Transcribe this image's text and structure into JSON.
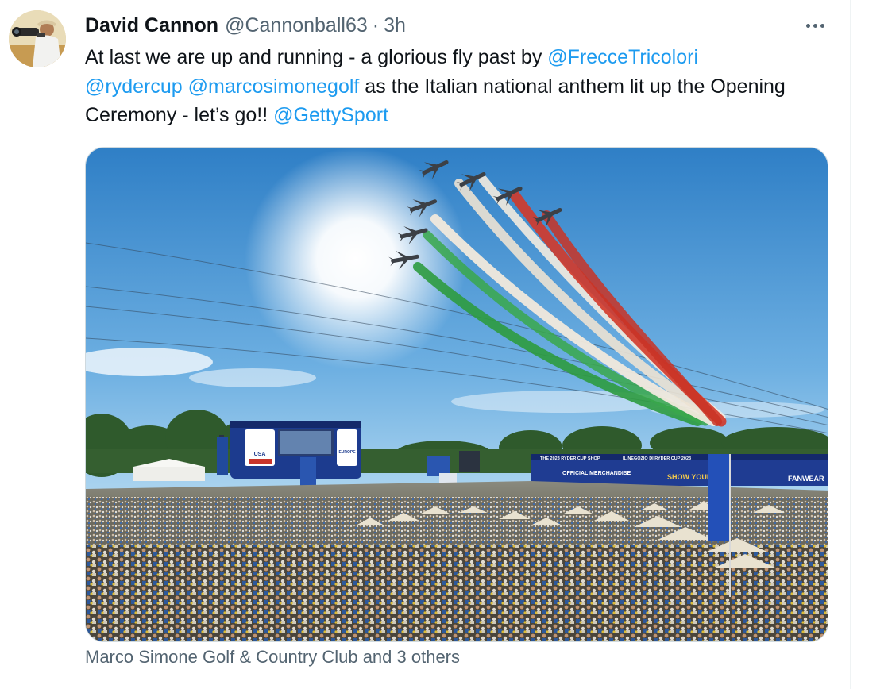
{
  "tweet": {
    "author": {
      "display_name": "David Cannon",
      "handle": "@Cannonball63",
      "separator": "·",
      "time": "3h"
    },
    "text_parts": [
      {
        "type": "text",
        "value": "At last we are up and running - a glorious fly past by "
      },
      {
        "type": "mention",
        "value": "@FrecceTricolori"
      },
      {
        "type": "text",
        "value": " "
      },
      {
        "type": "mention",
        "value": "@rydercup"
      },
      {
        "type": "text",
        "value": " "
      },
      {
        "type": "mention",
        "value": "@marcosimonegolf"
      },
      {
        "type": "text",
        "value": " as the Italian national anthem lit up the Opening Ceremony - let’s go!! "
      },
      {
        "type": "mention",
        "value": "@GettySport"
      }
    ],
    "media": {
      "signage": {
        "usa": "USA",
        "europe": "EUROPE",
        "shop": "THE 2023 RYDER CUP SHOP",
        "negozio": "IL NEGOZIO DI RYDER CUP 2023",
        "merch": "OFFICIAL MERCHANDISE",
        "show": "SHOW YOUR",
        "fan": "FANWEAR"
      }
    },
    "tagged_location": "Marco Simone Golf & Country Club and 3 others"
  },
  "colors": {
    "link": "#1d9bf0",
    "text": "#0f1419",
    "muted": "#536471",
    "smoke_green": "#2e9b3f",
    "smoke_white": "#f1e9dc",
    "smoke_red": "#d2382a"
  },
  "icons": {
    "more": "more-horizontal-icon"
  }
}
